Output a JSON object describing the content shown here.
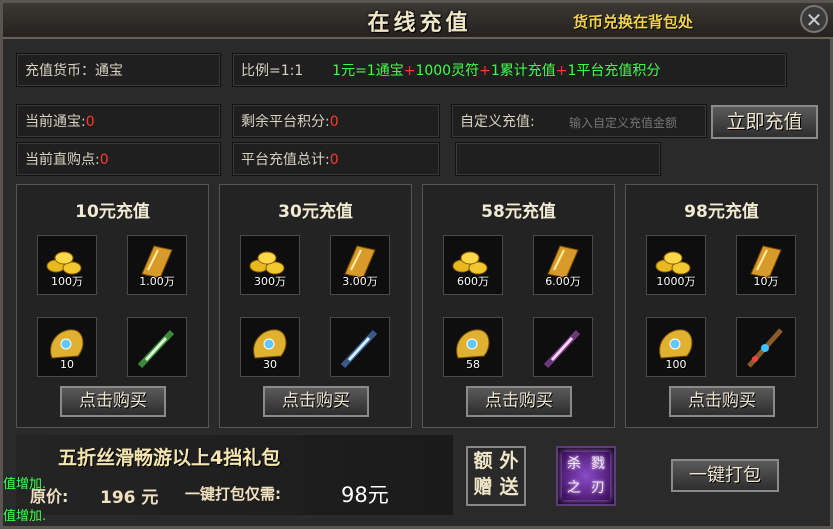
{
  "title": "在线充值",
  "title_hint": "货币兑换在背包处",
  "info": {
    "currency_label": "充值货币：",
    "currency_value": "通宝",
    "ratio_label": "比例=1:1",
    "ratio_parts": [
      {
        "text": "1元=1通宝"
      },
      {
        "text": "1000灵符"
      },
      {
        "text": "1累计充值"
      },
      {
        "text": "1平台充值积分"
      }
    ],
    "plus": "+",
    "current_tongbao_label": "当前通宝:",
    "current_tongbao_value": "0",
    "remaining_points_label": "剩余平台积分:",
    "remaining_points_value": "0",
    "custom_label": "自定义充值:",
    "custom_placeholder": "输入自定义充值金额",
    "recharge_button": "立即充值",
    "direct_points_label": "当前直购点:",
    "direct_points_value": "0",
    "total_recharge_label": "平台充值总计:",
    "total_recharge_value": "0"
  },
  "packs": [
    {
      "title": "10元充值",
      "items": [
        {
          "icon": "gold-ingots-icon",
          "qty": "100万"
        },
        {
          "icon": "golden-scroll-icon",
          "qty": "1.00万"
        },
        {
          "icon": "gem-pouch-icon",
          "qty": "10"
        },
        {
          "icon": "green-crystal-icon",
          "qty": ""
        }
      ],
      "buy": "点击购买"
    },
    {
      "title": "30元充值",
      "items": [
        {
          "icon": "gold-ingots-icon",
          "qty": "300万"
        },
        {
          "icon": "golden-scroll-icon",
          "qty": "3.00万"
        },
        {
          "icon": "gem-pouch-icon",
          "qty": "30"
        },
        {
          "icon": "blue-crystal-icon",
          "qty": ""
        }
      ],
      "buy": "点击购买"
    },
    {
      "title": "58元充值",
      "items": [
        {
          "icon": "gold-ingots-icon",
          "qty": "600万"
        },
        {
          "icon": "golden-scroll-icon",
          "qty": "6.00万"
        },
        {
          "icon": "gem-pouch-icon",
          "qty": "58"
        },
        {
          "icon": "purple-crystal-icon",
          "qty": ""
        }
      ],
      "buy": "点击购买"
    },
    {
      "title": "98元充值",
      "items": [
        {
          "icon": "gold-ingots-icon",
          "qty": "1000万"
        },
        {
          "icon": "golden-scroll-icon",
          "qty": "10万"
        },
        {
          "icon": "gem-pouch-icon",
          "qty": "100"
        },
        {
          "icon": "staff-icon",
          "qty": ""
        }
      ],
      "buy": "点击购买"
    }
  ],
  "bottom": {
    "promo_title": "五折丝滑畅游以上4挡礼包",
    "orig_label": "原价:",
    "orig_value": "196 元",
    "pack_label": "一键打包仅需:",
    "pack_value": "98元",
    "extra_chars": [
      "额",
      "外",
      "赠",
      "送"
    ],
    "special_chars": [
      "杀",
      "戮",
      "之",
      "刃"
    ],
    "pack_button": "一键打包",
    "side_lines": [
      "值增加.",
      "值增加."
    ]
  },
  "colors": {
    "accent_green": "#3dff4a",
    "accent_red": "#ff3a2a",
    "title_hint": "#f0d24a"
  }
}
